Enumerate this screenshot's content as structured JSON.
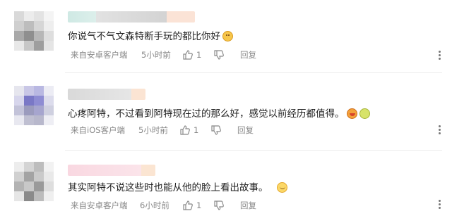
{
  "comments": [
    {
      "text": "你说气不气文森特断手玩的都比你好",
      "emoji": "dog-face-emoji",
      "source": "来自安卓客户端",
      "time": "5小时前",
      "likes": "1",
      "reply_label": "回复"
    },
    {
      "text": "心疼阿特，不过看到阿特现在过的那么好，感觉以前经历都值得。",
      "emoji": "crying-face-emoji",
      "source": "来自iOS客户端",
      "time": "5小时前",
      "likes": "1",
      "reply_label": "回复"
    },
    {
      "text": "其实阿特不说这些时也能从他的脸上看出故事。",
      "emoji": "smiling-face-emoji",
      "source": "来自安卓客户端",
      "time": "6小时前",
      "likes": "1",
      "reply_label": "回复"
    }
  ],
  "icons": {
    "like": "thumbs-up-icon",
    "dislike": "thumbs-down-icon",
    "more": "more-vertical-icon"
  },
  "colors": {
    "text": "#222222",
    "meta": "#888888",
    "separator": "#ececec"
  }
}
